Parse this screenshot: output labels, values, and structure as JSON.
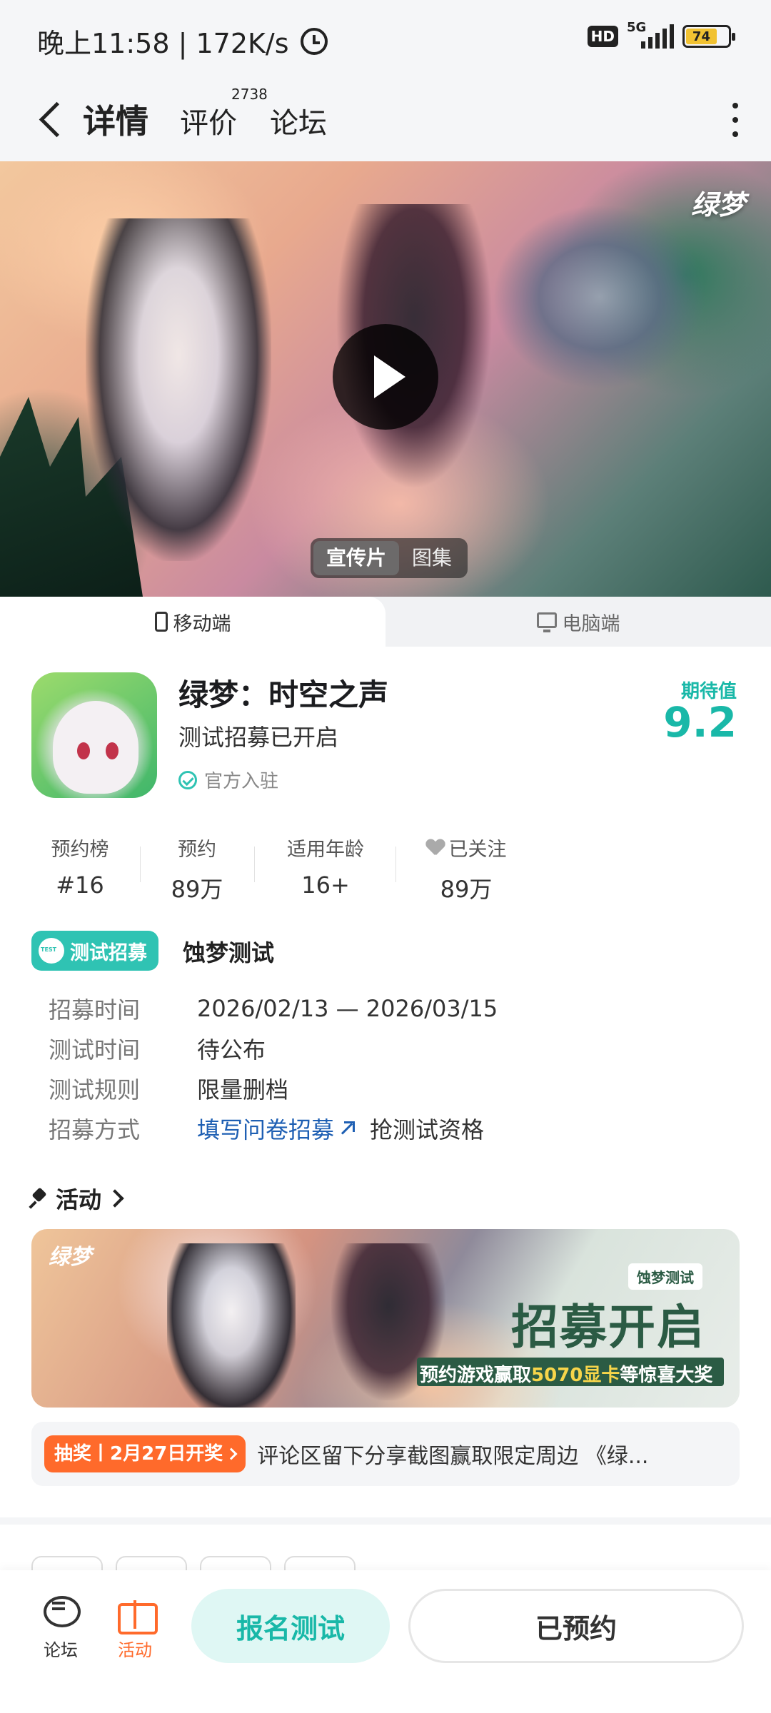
{
  "status_bar": {
    "time_speed": "晚上11:58 | 172K/s",
    "hd": "HD",
    "network": "5G",
    "battery": "74"
  },
  "nav": {
    "tabs": [
      {
        "label": "详情",
        "active": true
      },
      {
        "label": "评价",
        "count": "2738"
      },
      {
        "label": "论坛"
      }
    ]
  },
  "hero": {
    "logo_text": "绿梦",
    "media_tabs": [
      "宣传片",
      "图集"
    ]
  },
  "platform_tabs": [
    "移动端",
    "电脑端"
  ],
  "app": {
    "title": "绿梦：时空之声",
    "subtitle": "测试招募已开启",
    "official": "官方入驻",
    "score_label": "期待值",
    "score": "9.2"
  },
  "stats": [
    {
      "label": "预约榜",
      "value": "#16"
    },
    {
      "label": "预约",
      "value": "89万"
    },
    {
      "label": "适用年龄",
      "value": "16+"
    },
    {
      "label": "已关注",
      "value": "89万"
    }
  ],
  "recruitment": {
    "badge": "测试招募",
    "name": "蚀梦测试",
    "rows": [
      {
        "key": "招募时间",
        "value": "2026/02/13 — 2026/03/15"
      },
      {
        "key": "测试时间",
        "value": "待公布"
      },
      {
        "key": "测试规则",
        "value": "限量删档"
      },
      {
        "key": "招募方式",
        "value": "填写问卷招募",
        "extra": "抢测试资格"
      }
    ]
  },
  "activity": {
    "header": "活动",
    "banner": {
      "logo": "绿梦",
      "tag": "蚀梦测试",
      "headline": "招募开启",
      "line_prefix": "预约游戏赢取",
      "line_highlight": "5070显卡",
      "line_suffix": "等惊喜大奖"
    },
    "lottery_tag": "抽奖丨2月27日开奖",
    "lottery_text": "评论区留下分享截图赢取限定周边 《绿..."
  },
  "bottom_bar": {
    "forum": "论坛",
    "activity": "活动",
    "signup": "报名测试",
    "reserved": "已预约"
  },
  "colors": {
    "accent": "#19b8a8",
    "orange": "#ff6a2b",
    "link": "#1e5fb3"
  }
}
